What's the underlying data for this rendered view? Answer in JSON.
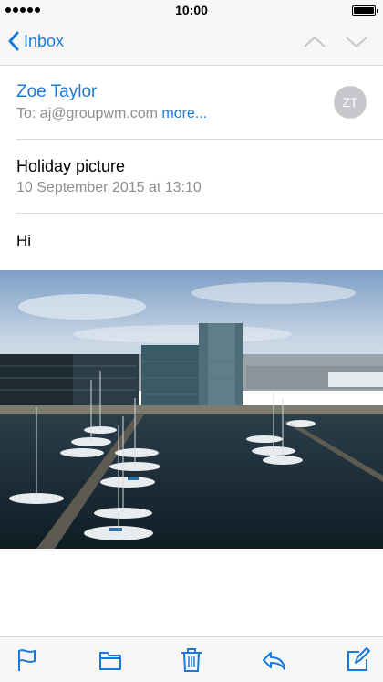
{
  "status_bar": {
    "time": "10:00"
  },
  "nav": {
    "back_label": "Inbox",
    "prev_icon": "chevron-up-icon",
    "next_icon": "chevron-down-icon",
    "accent_color": "#1a7ad9",
    "disabled_color": "#c7c7cc"
  },
  "email": {
    "sender_name": "Zoe Taylor",
    "to_prefix": "To: ",
    "to_address": "aj@groupwm.com",
    "more_label": "more...",
    "avatar_initials": "ZT",
    "subject": "Holiday picture",
    "date": "10 September 2015 at 13:10",
    "body": "Hi",
    "attachment": "harbour-photo"
  },
  "toolbar": {
    "icons": [
      "flag-icon",
      "folder-icon",
      "trash-icon",
      "reply-icon",
      "compose-icon"
    ]
  }
}
